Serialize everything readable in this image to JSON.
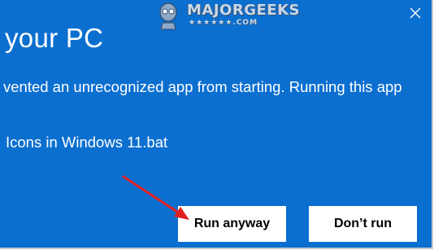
{
  "dialog": {
    "title": "your PC",
    "message": "vented an unrecognized app from starting. Running this app",
    "filename": "Icons in Windows 11.bat",
    "close_icon": "close-icon",
    "background_color": "#0b6fd0"
  },
  "buttons": {
    "run_anyway": "Run anyway",
    "dont_run": "Don’t run"
  },
  "watermark": {
    "name": "MAJORGEEKS",
    "sub": "★★★★★★.COM",
    "icon": "geek-mascot-logo"
  },
  "annotation": {
    "icon": "red-arrow-icon",
    "color": "#e02020"
  }
}
